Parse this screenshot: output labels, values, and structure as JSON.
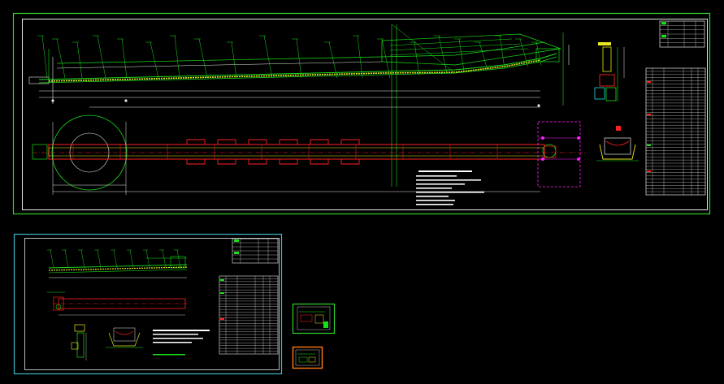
{
  "canvas": {
    "background": "#000000"
  },
  "colors": {
    "frame": "#2fd42f",
    "frame_alt": "#3fb6c8",
    "green": "#18e018",
    "yellow": "#e8e820",
    "red": "#ff2020",
    "white": "#ffffff",
    "magenta": "#ff20ff",
    "cyan": "#20e0e0",
    "orange": "#ff7a1a"
  },
  "sheets": [
    {
      "id": "sheet-main",
      "name": "main-drawing-sheet"
    },
    {
      "id": "sheet-secondary",
      "name": "secondary-drawing-sheet"
    },
    {
      "id": "thumb-1",
      "name": "detail-thumbnail-green"
    },
    {
      "id": "thumb-2",
      "name": "detail-thumbnail-orange"
    }
  ]
}
